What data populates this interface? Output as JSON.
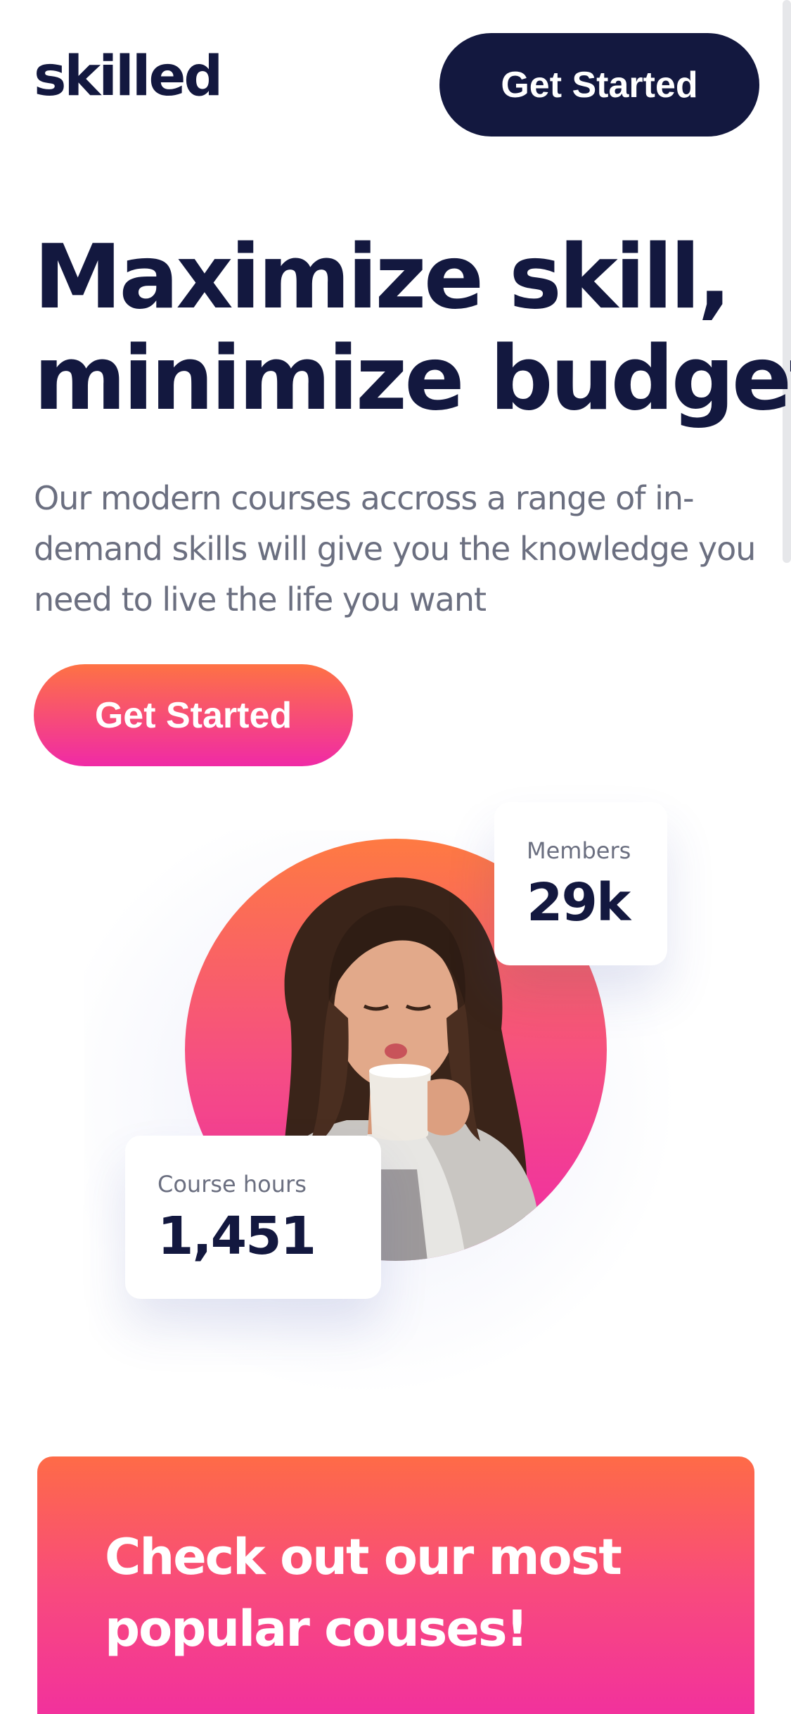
{
  "header": {
    "logo": "skilled",
    "cta_label": "Get Started"
  },
  "hero": {
    "title_line1": "Maximize skill,",
    "title_line2": "minimize budget",
    "description": "Our modern courses accross a range of in-demand skills will give you the knowledge you need to live the life you want",
    "cta_label": "Get Started"
  },
  "stats": {
    "members": {
      "label": "Members",
      "value": "29k"
    },
    "course_hours": {
      "label": "Course hours",
      "value": "1,451"
    }
  },
  "courses_banner": {
    "title_line1": "Check out our most",
    "title_line2": "popular couses!"
  },
  "colors": {
    "navy": "#13183f",
    "gradient_start": "#fe7244",
    "gradient_end": "#f02aa6",
    "muted_text": "#6b6f80"
  }
}
